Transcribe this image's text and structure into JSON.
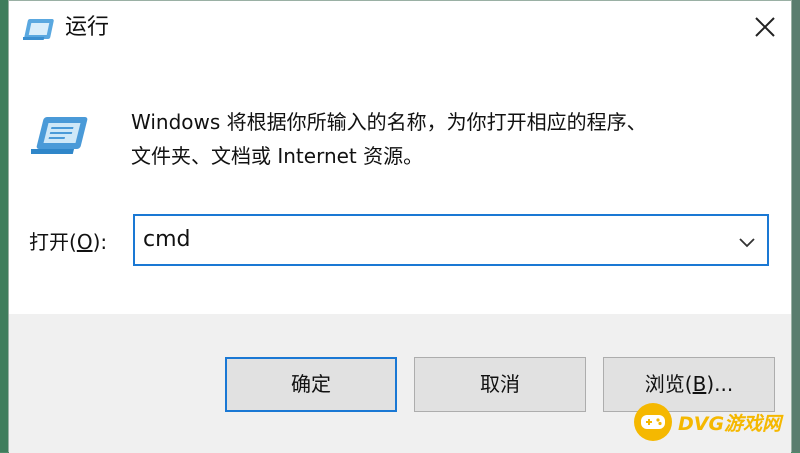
{
  "window": {
    "title": "运行",
    "title_icon": "run-icon",
    "close_icon": "close-icon"
  },
  "content": {
    "icon": "run-large-icon",
    "description_line1": "Windows 将根据你所输入的名称，为你打开相应的程序、",
    "description_line2": "文件夹、文档或 Internet 资源。",
    "open_label_prefix": "打开(",
    "open_label_key": "O",
    "open_label_suffix": "):",
    "input_value": "cmd",
    "dropdown_icon": "chevron-down-icon"
  },
  "buttons": {
    "ok_label": "确定",
    "cancel_label": "取消",
    "browse_prefix": "浏览(",
    "browse_key": "B",
    "browse_suffix": ")..."
  },
  "watermark": {
    "text": "DVG游戏网"
  },
  "colors": {
    "accent": "#1a78d4",
    "footer_bg": "#f0f0f0",
    "button_bg": "#e1e1e1",
    "watermark": "#f5b800"
  }
}
